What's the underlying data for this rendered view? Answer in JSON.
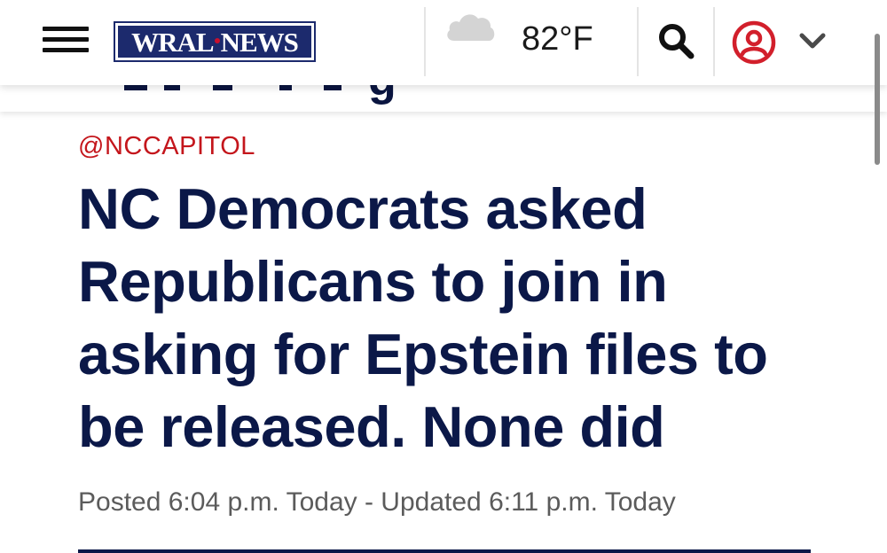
{
  "header": {
    "logo_text_left": "WRAL",
    "logo_text_right": "NEWS",
    "weather_icon": "cloud-icon",
    "temperature": "82°F",
    "search_icon": "search-icon",
    "account_icon": "account-icon",
    "menu_icon": "hamburger-menu-icon",
    "dropdown_icon": "chevron-down-icon"
  },
  "previous_headline_fragment": "g",
  "article": {
    "section_tag": "@NCCAPITOL",
    "headline": "NC Democrats asked Republicans to join in asking for Epstein files to be released. None did",
    "timestamp": "Posted 6:04 p.m. Today - Updated 6:11 p.m. Today"
  },
  "colors": {
    "brand_navy": "#1c2a6d",
    "headline": "#0b1848",
    "section_red": "#c4161c",
    "account_red": "#d21f2b"
  }
}
